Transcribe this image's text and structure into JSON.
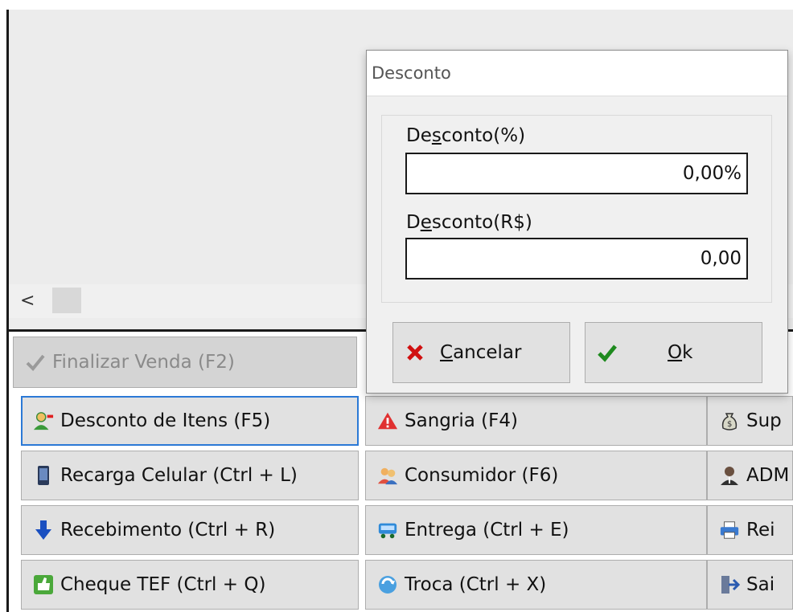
{
  "dialog": {
    "title": "Desconto",
    "percent_label_pre": "De",
    "percent_label_key": "s",
    "percent_label_post": "conto(%)",
    "percent_value": "0,00%",
    "amount_label_pre": "D",
    "amount_label_key": "e",
    "amount_label_post": "sconto(R$)",
    "amount_value": "0,00",
    "cancel_key": "C",
    "cancel_rest": "ancelar",
    "ok_key": "O",
    "ok_rest": "k"
  },
  "scrollbar": {
    "left_arrow": "<"
  },
  "buttons": {
    "finalizar": "Finalizar Venda (F2)",
    "desconto_itens": "Desconto de Itens (F5)",
    "sangria": "Sangria (F4)",
    "suprimento": "Sup",
    "recarga": "Recarga Celular (Ctrl + L)",
    "consumidor": "Consumidor (F6)",
    "adm": "ADM",
    "recebimento": "Recebimento (Ctrl + R)",
    "entrega": "Entrega (Ctrl + E)",
    "reimprimir": "Rei",
    "cheque": "Cheque TEF (Ctrl + Q)",
    "troca": "Troca (Ctrl + X)",
    "sair": "Sai"
  },
  "colors": {
    "focus_border": "#2b79d6",
    "cancel_icon": "#d01010",
    "ok_icon": "#1e8a1e"
  }
}
